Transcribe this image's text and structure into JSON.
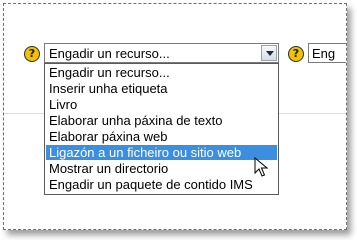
{
  "resource_select": {
    "selected": "Engadir un recurso...",
    "options": [
      "Engadir un recurso...",
      "Inserir unha etiqueta",
      "Livro",
      "Elaborar unha páxina de texto",
      "Elaborar páxina web",
      "Ligazón a un ficheiro ou sitio web",
      "Mostrar un directorio",
      "Engadir un paquete de contido IMS"
    ],
    "highlighted_index": 5
  },
  "activity_select": {
    "visible_text": "Eng"
  },
  "help_icon_label": "?",
  "colors": {
    "highlight": "#3b8ee0",
    "help_icon": "#f2c200"
  }
}
